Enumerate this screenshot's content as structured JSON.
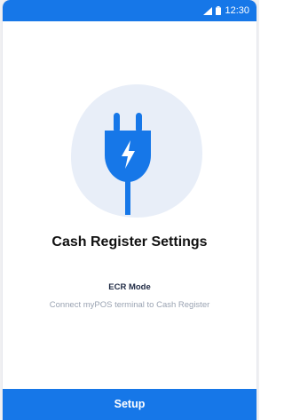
{
  "status_bar": {
    "time": "12:30",
    "icons": [
      "signal-icon",
      "battery-icon"
    ],
    "background_color": "#1677e8"
  },
  "main": {
    "illustration_icon": "power-plug-icon",
    "title": "Cash Register Settings",
    "mode_label": "ECR Mode",
    "description": "Connect myPOS terminal to Cash Register"
  },
  "footer": {
    "setup_label": "Setup",
    "button_color": "#1677e8"
  },
  "colors": {
    "accent": "#1677e8",
    "blob": "#e8eef8",
    "text_primary": "#111111",
    "text_secondary": "#9aa3b2"
  }
}
